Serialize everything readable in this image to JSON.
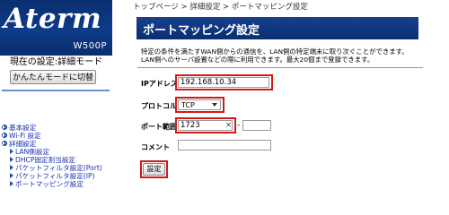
{
  "sidebar": {
    "logo": "Aterm",
    "model": "W500P",
    "mode_line": "現在の設定:詳細モード",
    "simple_mode_button": "かんたんモードに切替",
    "nav": [
      {
        "label": "基本設定",
        "level": 1
      },
      {
        "label": "Wi-Fi 設定",
        "level": 1
      },
      {
        "label": "詳細設定",
        "level": 1
      },
      {
        "label": "LAN側設定",
        "level": 2
      },
      {
        "label": "DHCP固定割当設定",
        "level": 2
      },
      {
        "label": "パケットフィルタ設定(Port)",
        "level": 2
      },
      {
        "label": "パケットフィルタ設定(IP)",
        "level": 2
      },
      {
        "label": "ポートマッピング設定",
        "level": 2
      }
    ]
  },
  "header": {
    "breadcrumb": "トップページ > 詳細設定 > ポートマッピング設定",
    "title": "ポートマッピング設定"
  },
  "description": {
    "line1": "特定の条件を満たすWAN側からの通信を、LAN側の特定端末に取り次ぐことができます。",
    "line2": "LAN側へのサーバ設置などの際に利用できます。最大20個まで登録できます。"
  },
  "form": {
    "ip_label": "IPアドレス",
    "ip_value": "192.168.10.34",
    "protocol_label": "プロトコル",
    "protocol_value": "TCP",
    "port_label": "ポート範囲",
    "port_start_value": "1723",
    "port_end_value": "",
    "range_dash": "-",
    "clear_icon": "×",
    "comment_label": "コメント",
    "comment_value": "",
    "submit_label": "設定"
  },
  "colors": {
    "brand_navy": "#0b2e70",
    "highlight_red": "#d01a1a",
    "link_blue": "#1a2fb0"
  },
  "icons": [
    "circle-arrow-icon",
    "arrow-icon",
    "clear-icon",
    "chevron-down-icon"
  ]
}
